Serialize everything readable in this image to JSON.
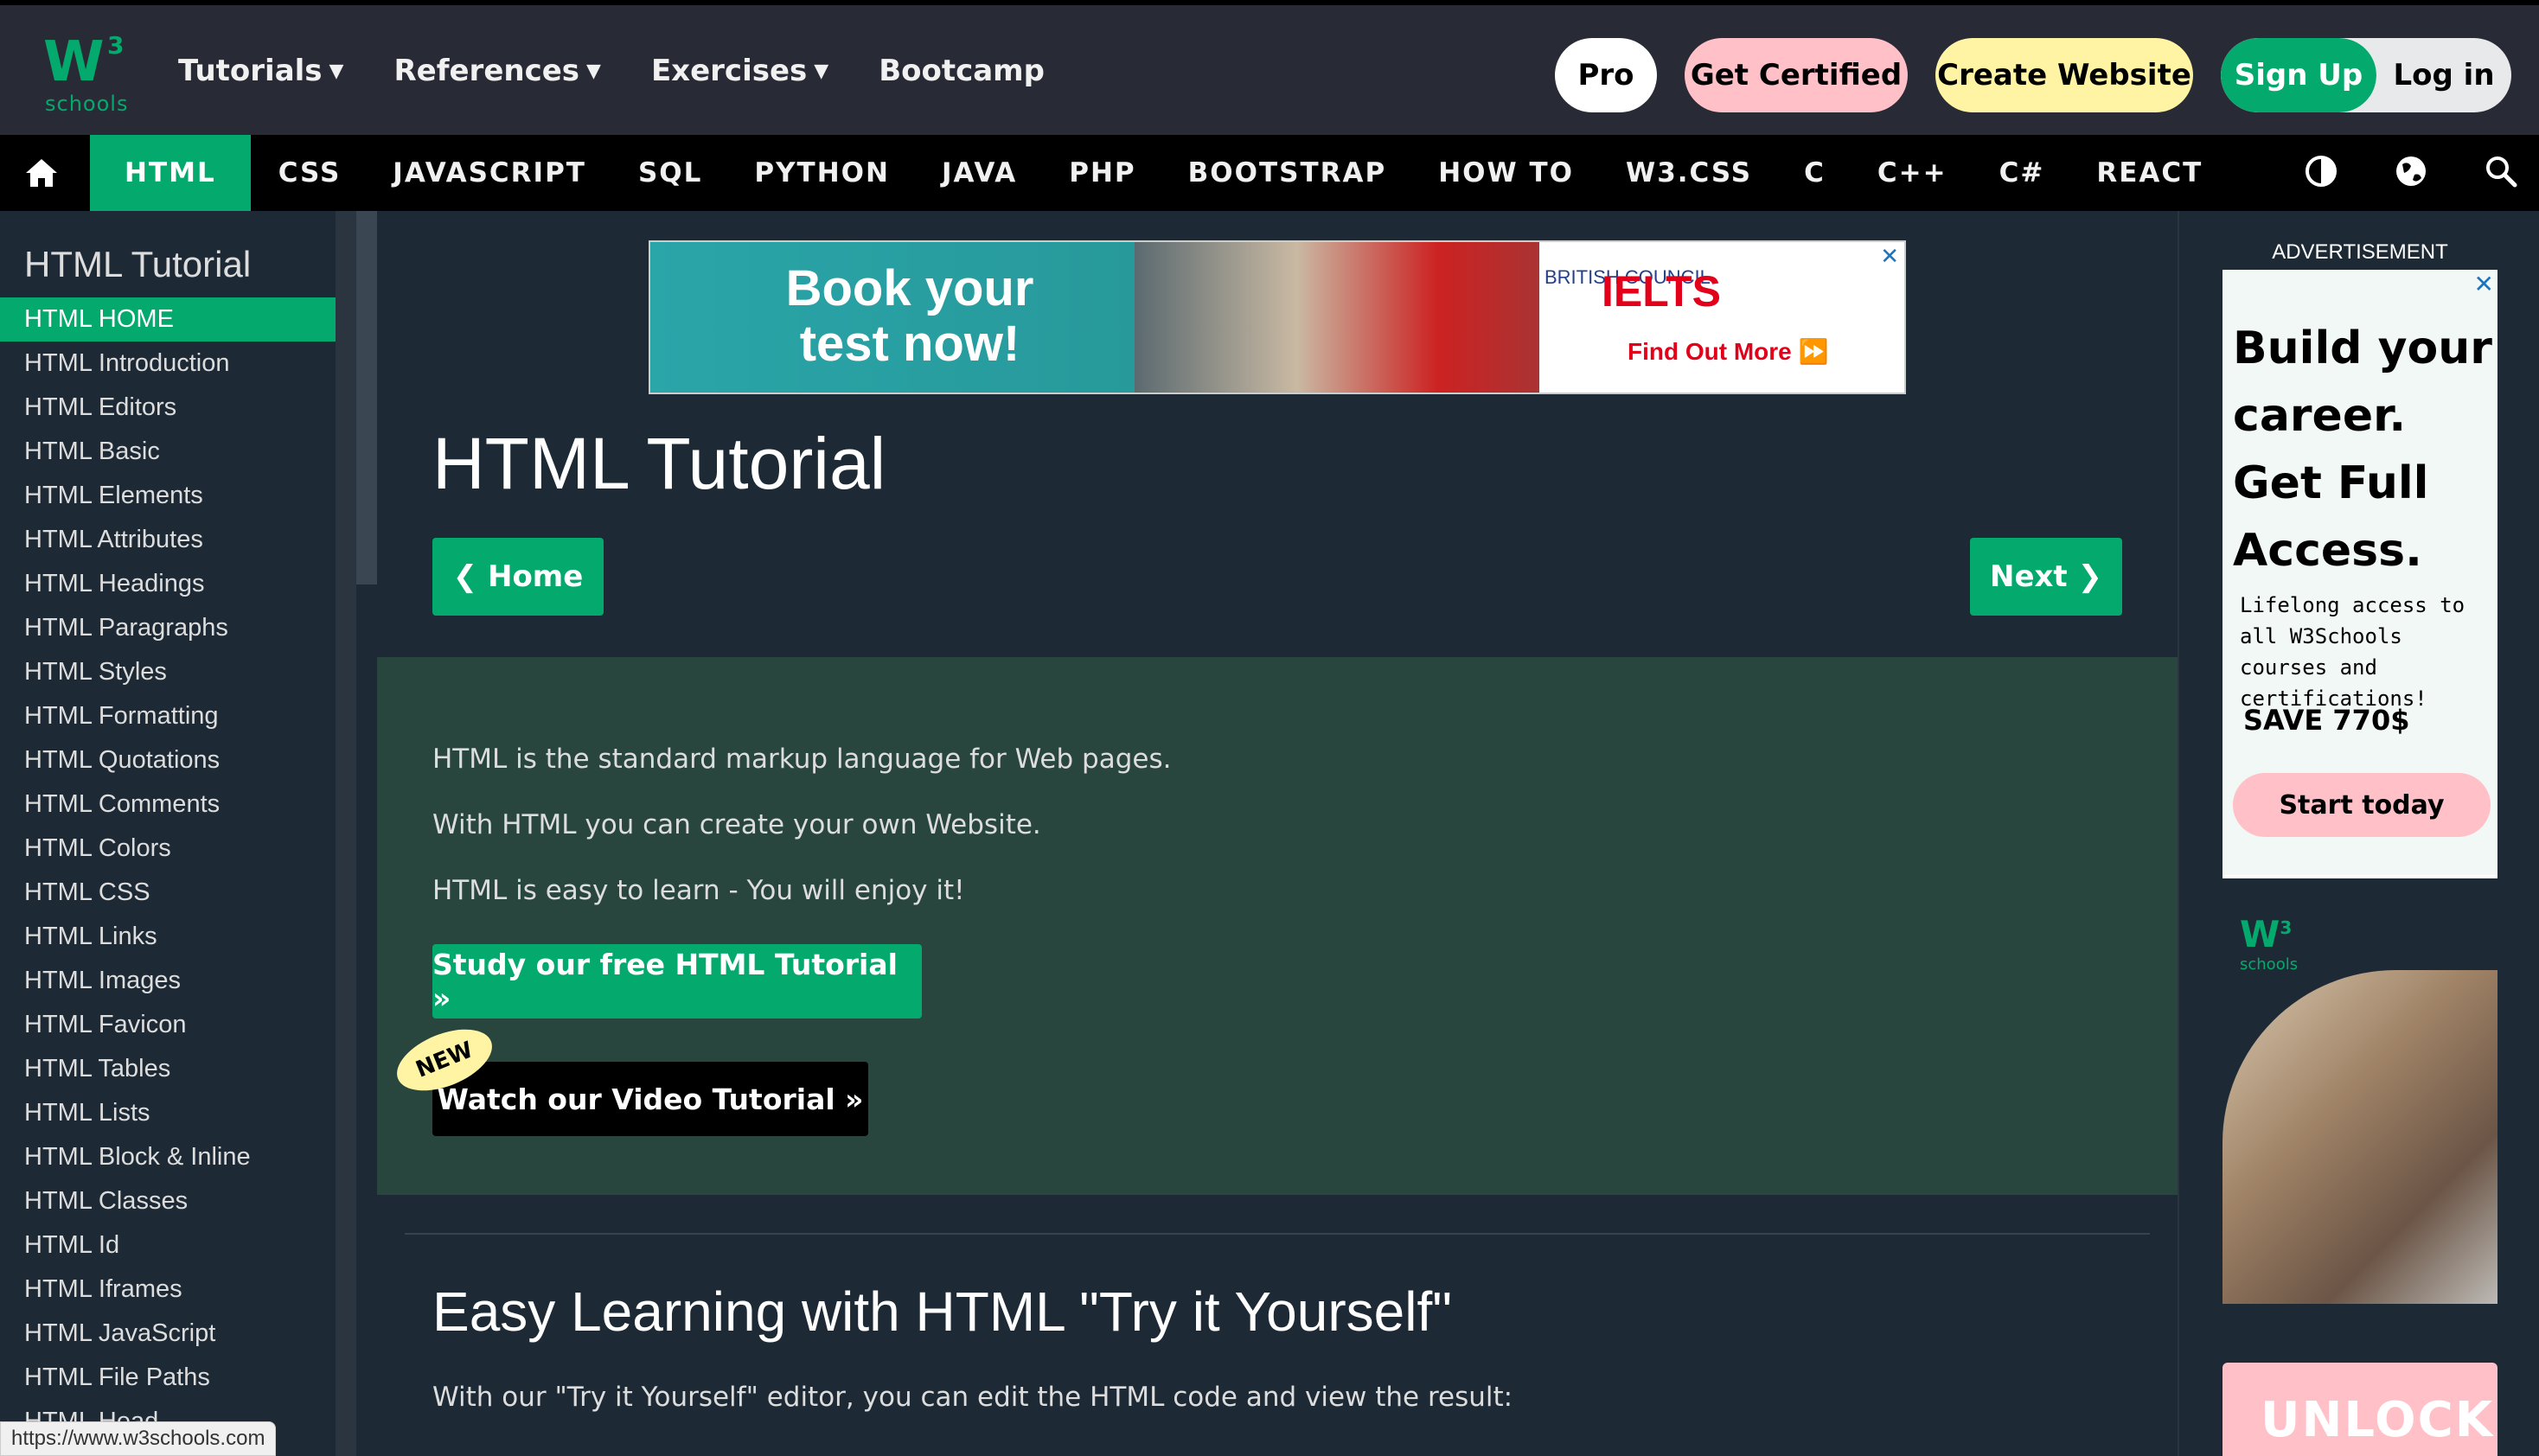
{
  "logo": {
    "text": "W",
    "sup": "3",
    "sub": "schools"
  },
  "top_nav": [
    {
      "label": "Tutorials",
      "has_caret": true
    },
    {
      "label": "References",
      "has_caret": true
    },
    {
      "label": "Exercises",
      "has_caret": true
    },
    {
      "label": "Bootcamp",
      "has_caret": false
    }
  ],
  "top_buttons": {
    "pro": "Pro",
    "certified": "Get Certified",
    "create": "Create Website",
    "signup": "Sign Up",
    "login": "Log in"
  },
  "sub_nav": [
    "HTML",
    "CSS",
    "JAVASCRIPT",
    "SQL",
    "PYTHON",
    "JAVA",
    "PHP",
    "BOOTSTRAP",
    "HOW TO",
    "W3.CSS",
    "C",
    "C++",
    "C#",
    "REACT"
  ],
  "sub_nav_active": "HTML",
  "sidebar": {
    "title": "HTML Tutorial",
    "items": [
      "HTML HOME",
      "HTML Introduction",
      "HTML Editors",
      "HTML Basic",
      "HTML Elements",
      "HTML Attributes",
      "HTML Headings",
      "HTML Paragraphs",
      "HTML Styles",
      "HTML Formatting",
      "HTML Quotations",
      "HTML Comments",
      "HTML Colors",
      "HTML CSS",
      "HTML Links",
      "HTML Images",
      "HTML Favicon",
      "HTML Tables",
      "HTML Lists",
      "HTML Block & Inline",
      "HTML Classes",
      "HTML Id",
      "HTML Iframes",
      "HTML JavaScript",
      "HTML File Paths",
      "HTML Head"
    ],
    "active_index": 0
  },
  "ad_top": {
    "headline": "Book your test now!",
    "brand": "IELTS",
    "org": "BRITISH COUNCIL",
    "cta": "Find Out More ⏩"
  },
  "main": {
    "title": "HTML Tutorial",
    "prev_label": "❮ Home",
    "next_label": "Next ❯",
    "intro": [
      "HTML is the standard markup language for Web pages.",
      "With HTML you can create your own Website.",
      "HTML is easy to learn - You will enjoy it!"
    ],
    "study_btn": "Study our free HTML Tutorial »",
    "video_btn": "Watch our Video Tutorial »",
    "new_badge": "NEW",
    "section_title": "Easy Learning with HTML \"Try it Yourself\"",
    "section_text": "With our \"Try it Yourself\" editor, you can edit the HTML code and view the result:"
  },
  "right_ad": {
    "label": "ADVERTISEMENT",
    "headline": "Build your career. Get Full Access.",
    "sub": "Lifelong access to all W3Schools courses and certifications!",
    "save": "SAVE 770$",
    "cta": "Start today",
    "logo_sub": "schools",
    "unlock": "UNLOCK"
  },
  "status_url": "https://www.w3schools.com",
  "colors": {
    "accent": "#04aa6d",
    "dark": "#282a35",
    "bg": "#1d2a35",
    "intro_bg": "#28453e"
  }
}
